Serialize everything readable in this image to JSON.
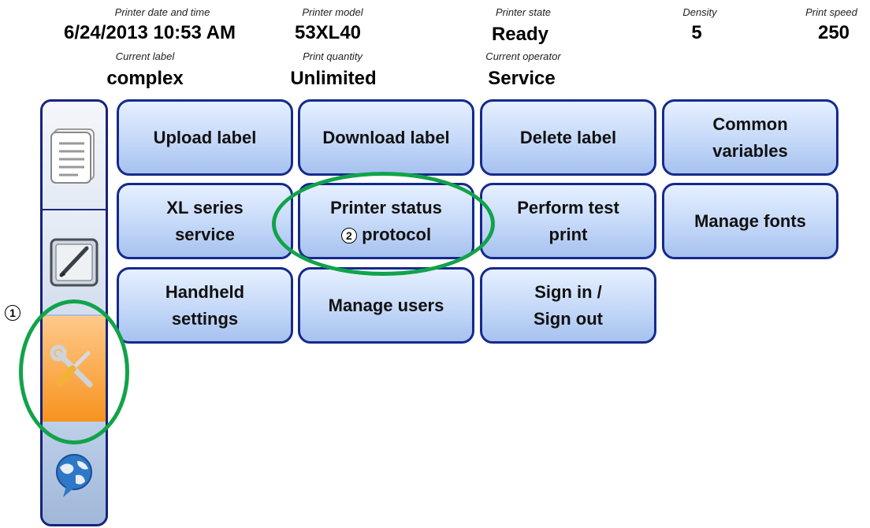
{
  "status": {
    "printer_datetime": {
      "caption": "Printer date and time",
      "value": "6/24/2013 10:53 AM"
    },
    "printer_model": {
      "caption": "Printer model",
      "value": "53XL40"
    },
    "printer_state": {
      "caption": "Printer state",
      "value": "Ready"
    },
    "density": {
      "caption": "Density",
      "value": "5"
    },
    "print_speed": {
      "caption": "Print speed",
      "value": "250"
    },
    "current_label": {
      "caption": "Current label",
      "value": "complex"
    },
    "print_quantity": {
      "caption": "Print quantity",
      "value": "Unlimited"
    },
    "current_operator": {
      "caption": "Current operator",
      "value": "Service"
    }
  },
  "sidebar": {
    "tabs": [
      {
        "icon": "document-list-icon"
      },
      {
        "icon": "pen-edit-icon"
      },
      {
        "icon": "tools-icon",
        "active": true
      },
      {
        "icon": "globe-chat-icon"
      }
    ]
  },
  "buttons": {
    "upload_label": [
      "Upload label"
    ],
    "download_label": [
      "Download label"
    ],
    "delete_label": [
      "Delete label"
    ],
    "common_variables": [
      "Common",
      "variables"
    ],
    "xl_series_service": [
      "XL series",
      "service"
    ],
    "printer_status_protocol": [
      "Printer status",
      "protocol"
    ],
    "perform_test_print": [
      "Perform test",
      "print"
    ],
    "manage_fonts": [
      "Manage fonts"
    ],
    "handheld_settings": [
      "Handheld",
      "settings"
    ],
    "manage_users": [
      "Manage users"
    ],
    "sign_in_out": [
      "Sign in /",
      "Sign out"
    ]
  },
  "annotations": {
    "marker_1": "1",
    "marker_2": "2",
    "highlight_color": "#12a34a"
  },
  "colors": {
    "button_border": "#152a8c",
    "active_tab": "#f7931e"
  }
}
